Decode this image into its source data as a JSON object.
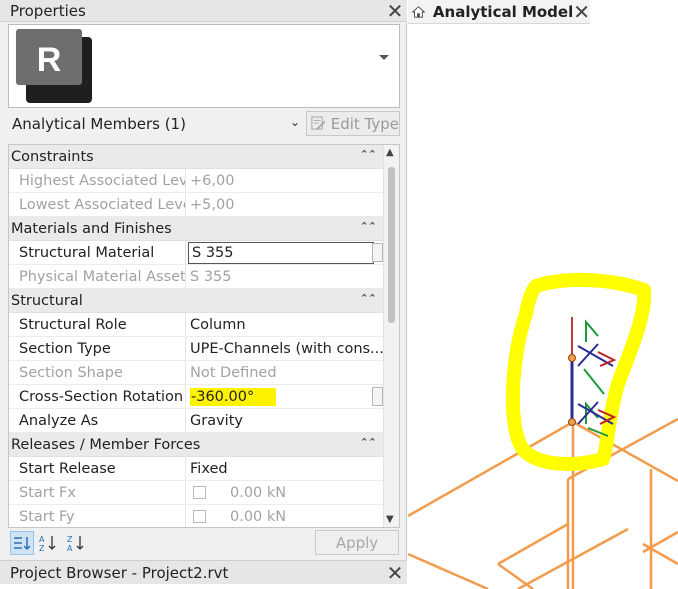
{
  "properties_panel": {
    "title": "Properties",
    "type_image": {
      "icon": "revit-logo-icon",
      "letter": "R"
    },
    "element_selector": "Analytical Members (1)",
    "edit_type_label": "Edit Type",
    "groups": [
      {
        "name": "Constraints",
        "rows": [
          {
            "name": "Highest Associated Level",
            "value": "+6,00",
            "readonly": true
          },
          {
            "name": "Lowest Associated Level",
            "value": "+5,00",
            "readonly": true
          }
        ]
      },
      {
        "name": "Materials and Finishes",
        "rows": [
          {
            "name": "Structural Material",
            "value": "S 355",
            "readonly": false
          },
          {
            "name": "Physical Material Asset",
            "value": "S 355",
            "readonly": true
          }
        ]
      },
      {
        "name": "Structural",
        "rows": [
          {
            "name": "Structural Role",
            "value": "Column",
            "readonly": false
          },
          {
            "name": "Section Type",
            "value": "UPE-Channels (with cons...",
            "readonly": false
          },
          {
            "name": "Section Shape",
            "value": "Not Defined",
            "readonly": true
          },
          {
            "name": "Cross-Section Rotation",
            "value": "-360.00°",
            "readonly": false
          },
          {
            "name": "Analyze As",
            "value": "Gravity",
            "readonly": false
          }
        ]
      },
      {
        "name": "Releases / Member Forces",
        "rows": [
          {
            "name": "Start Release",
            "value": "Fixed",
            "readonly": false
          },
          {
            "name": "Start Fx",
            "value": "0.00 kN",
            "readonly": true
          },
          {
            "name": "Start Fy",
            "value": "0.00 kN",
            "readonly": true
          }
        ]
      }
    ],
    "apply_label": "Apply",
    "highlight_color": "#fff200"
  },
  "project_browser": {
    "title": "Project Browser - Project2.rvt"
  },
  "view": {
    "tab_label": "Analytical Model",
    "member_color": "#f29b4b",
    "annotation_color": "#ffff00"
  }
}
